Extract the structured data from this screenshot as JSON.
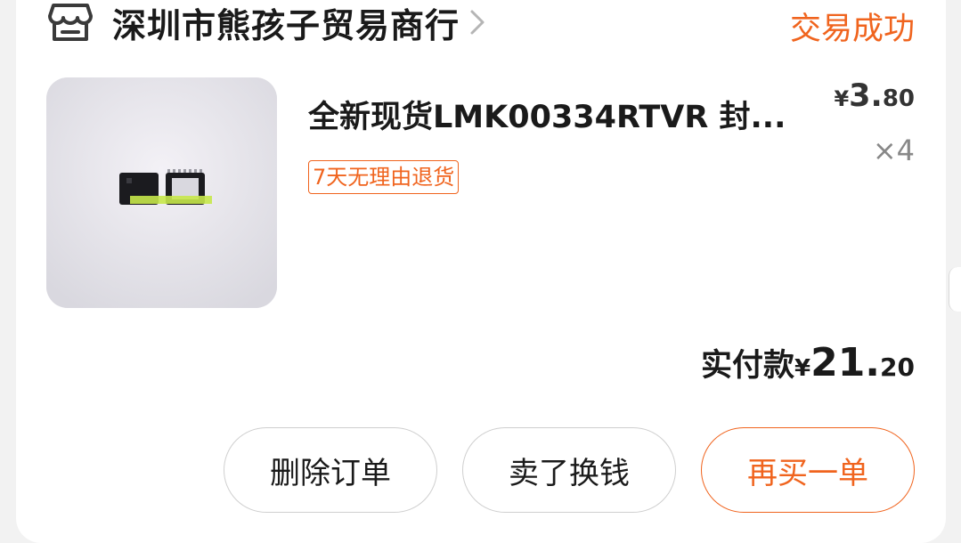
{
  "shop": {
    "name": "深圳市熊孩子贸易商行",
    "icon": "store-icon",
    "chevron_icon": "chevron-right-icon"
  },
  "order": {
    "status": "交易成功",
    "status_color": "#f0641e"
  },
  "product": {
    "title": "全新现货LMK00334RTVR 封...",
    "tag": "7天无理由退货",
    "price_currency": "¥",
    "price_integer": "3.",
    "price_decimal": "80",
    "quantity": "×4",
    "image_icon": "product-thumbnail"
  },
  "payment": {
    "label": "实付款",
    "currency": "¥",
    "integer": "21.",
    "decimal": "20"
  },
  "actions": {
    "delete_label": "删除订单",
    "sell_label": "卖了换钱",
    "rebuy_label": "再买一单"
  },
  "colors": {
    "accent": "#f0641e",
    "text": "#1a1a1a",
    "muted": "#888888",
    "background": "#f2f2f2",
    "card": "#ffffff"
  }
}
